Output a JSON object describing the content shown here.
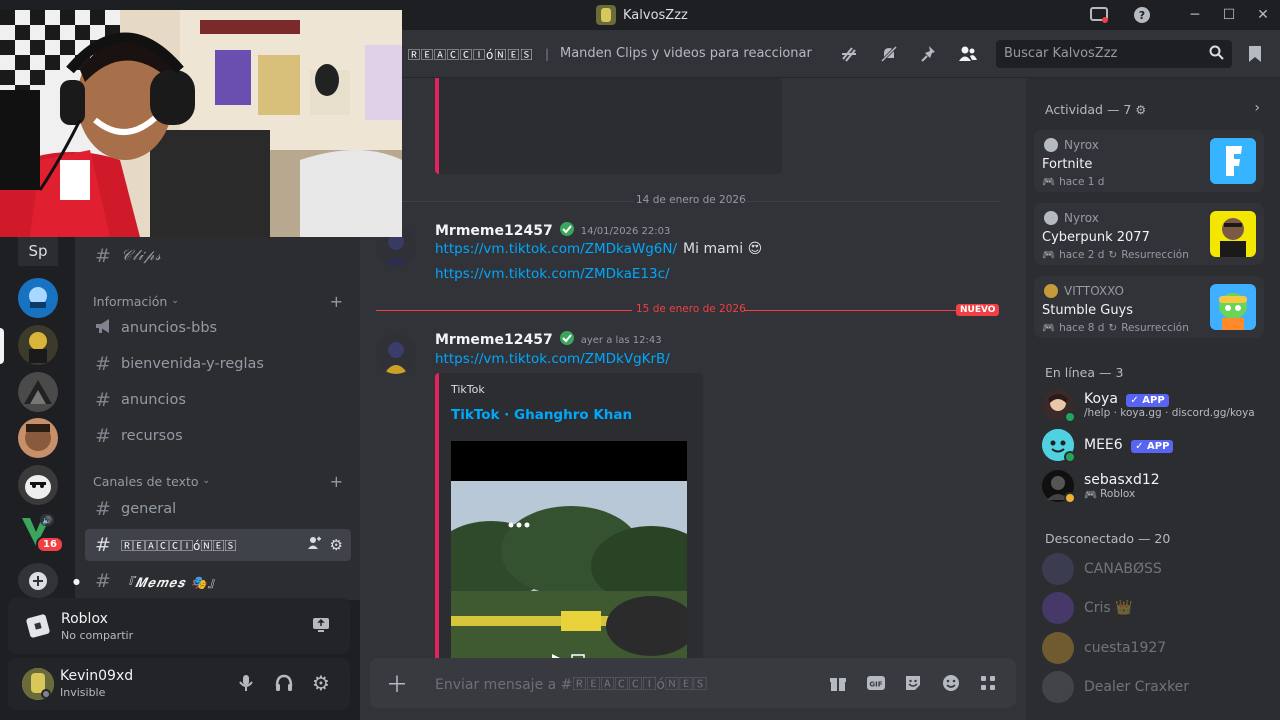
{
  "window": {
    "title": "KalvosZzz"
  },
  "server_rail": {
    "current_server_abbrev": "Sp",
    "notification_count": "16"
  },
  "sidebar": {
    "top_channel": "𝒞𝓁𝒾𝓅𝓈",
    "category_info": "Información",
    "info_channels": [
      "anuncios-bbs",
      "bienvenida-y-reglas",
      "anuncios",
      "recursos"
    ],
    "category_text": "Canales de texto",
    "text_channels": [
      "general",
      "🅁🄴🄰🄲🄲🄸ó🄽🄴🅂",
      "『𝑴𝒆𝒎𝒆𝒔 🎭』"
    ]
  },
  "activity_panel": {
    "game": "Roblox",
    "status": "No compartir"
  },
  "user": {
    "name": "Kevin09xd",
    "status": "Invisible"
  },
  "header": {
    "channel_name": "🅁🄴🄰🄲🄲🄸ó🄽🄴🅂",
    "topic": "Manden Clips y videos para reaccionar",
    "search_placeholder": "Buscar KalvosZzz"
  },
  "messages": {
    "date_1": "14 de enero de 2026",
    "msg1_author": "Mrmeme12457",
    "msg1_time": "14/01/2026 22:03",
    "msg1_link1": "https://vm.tiktok.com/ZMDkaWg6N/",
    "msg1_text": "Mi mami 😍",
    "msg1_link2": "https://vm.tiktok.com/ZMDkaE13c/",
    "date_2": "15 de enero de 2026",
    "new_label": "NUEVO",
    "msg2_author": "Mrmeme12457",
    "msg2_time": "ayer a las 12:43",
    "msg2_link": "https://vm.tiktok.com/ZMDkVgKrB/",
    "embed_provider": "TikTok",
    "embed_title": "TikTok · Ghanghro Khan"
  },
  "composer": {
    "placeholder": "Enviar mensaje a #🅁🄴🄰🄲🄲🄸ó🄽🄴🅂"
  },
  "members": {
    "activity_header": "Actividad — 7",
    "activities": [
      {
        "user": "Nyrox",
        "game": "Fortnite",
        "time": "hace 1 d",
        "extra": ""
      },
      {
        "user": "Nyrox",
        "game": "Cyberpunk 2077",
        "time": "hace 2 d",
        "extra": "Resurrección"
      },
      {
        "user": "VITTOXXO",
        "game": "Stumble Guys",
        "time": "hace 8 d",
        "extra": "Resurrección"
      }
    ],
    "online_header": "En línea — 3",
    "online": [
      {
        "name": "Koya",
        "badge": "APP",
        "sub": "/help · koya.gg · discord.gg/koya"
      },
      {
        "name": "MEE6",
        "badge": "APP",
        "sub": ""
      },
      {
        "name": "sebasxd12",
        "badge": "",
        "sub": "Roblox"
      }
    ],
    "offline_header": "Desconectado — 20",
    "offline": [
      "CANABØSS",
      "Cris 👑",
      "cuesta1927",
      "Dealer Craxker"
    ]
  }
}
